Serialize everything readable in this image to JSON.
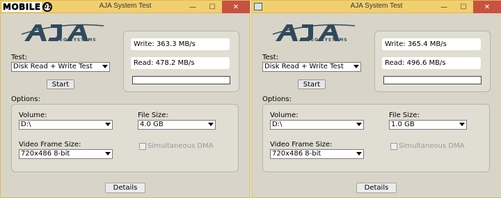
{
  "watermark": {
    "text": "MOBILE",
    "badge": "01"
  },
  "windows": [
    {
      "title": "AJA System Test",
      "logo": {
        "sub": "VIDEO SYSTEMS"
      },
      "test_label": "Test:",
      "test_value": "Disk Read + Write Test",
      "start_label": "Start",
      "write": "Write: 363.3 MB/s",
      "read": "Read: 478.2 MB/s",
      "progress": 0,
      "options_label": "Options:",
      "volume_label": "Volume:",
      "volume_value": "D:\\",
      "filesize_label": "File Size:",
      "filesize_value": "4.0 GB",
      "vfs_label": "Video Frame Size:",
      "vfs_value": "720x486 8-bit",
      "dma_label": "Simultaneous DMA",
      "details_label": "Details",
      "controls": {
        "minimize": "—",
        "maximize": "☐",
        "close": "✕"
      }
    },
    {
      "title": "AJA System Test",
      "logo": {
        "sub": "VIDEO SYSTEMS"
      },
      "test_label": "Test:",
      "test_value": "Disk Read + Write Test",
      "start_label": "Start",
      "write": "Write: 365.4 MB/s",
      "read": "Read: 496.6 MB/s",
      "progress": 0,
      "options_label": "Options:",
      "volume_label": "Volume:",
      "volume_value": "D:\\",
      "filesize_label": "File Size:",
      "filesize_value": "1.0 GB",
      "vfs_label": "Video Frame Size:",
      "vfs_value": "720x486 8-bit",
      "dma_label": "Simultaneous DMA",
      "details_label": "Details",
      "controls": {
        "minimize": "—",
        "maximize": "☐",
        "close": "✕"
      }
    }
  ],
  "colors": {
    "titlebar": "#f2cf6e",
    "close": "#c7523f",
    "window": "#d8d4c8",
    "logo": "#2f4a5d"
  }
}
